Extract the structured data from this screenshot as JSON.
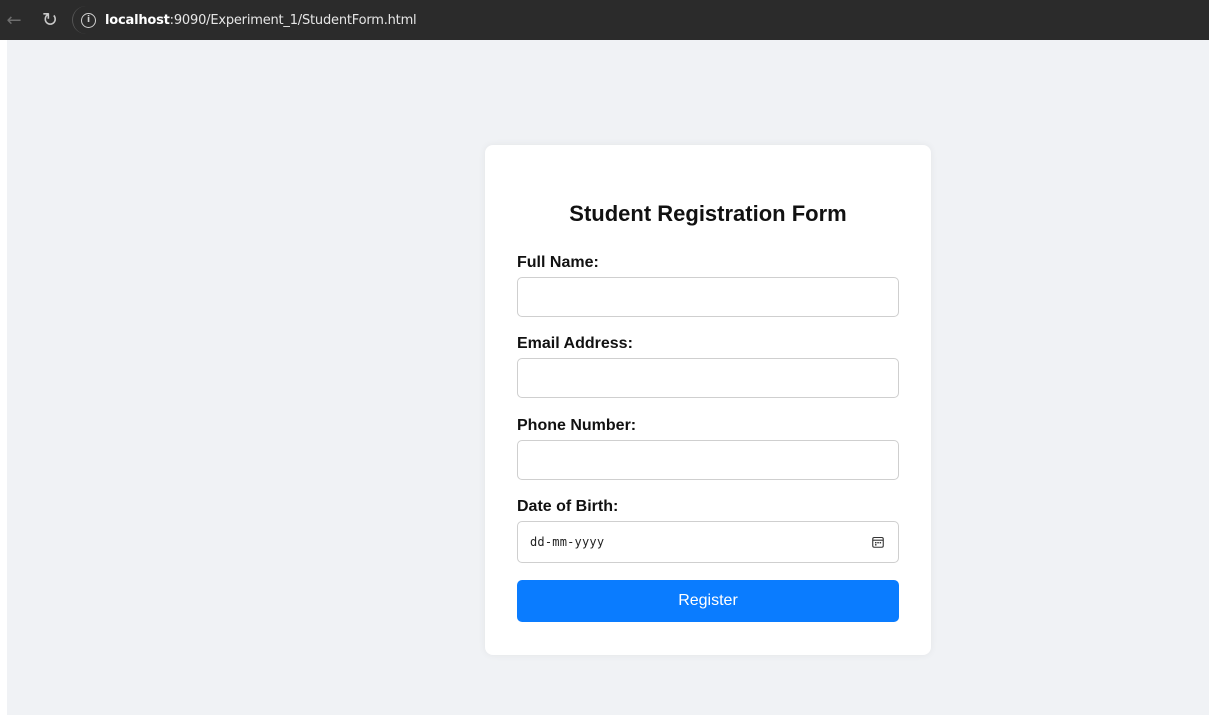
{
  "browser": {
    "url_host": "localhost",
    "url_path": ":9090/Experiment_1/StudentForm.html"
  },
  "form": {
    "title": "Student Registration Form",
    "fields": [
      {
        "label": "Full Name:",
        "value": ""
      },
      {
        "label": "Email Address:",
        "value": ""
      },
      {
        "label": "Phone Number:",
        "value": ""
      },
      {
        "label": "Date of Birth:",
        "placeholder": "dd-mm-yyyy"
      }
    ],
    "submit_label": "Register"
  },
  "colors": {
    "page_background": "#f0f2f5",
    "card_background": "#ffffff",
    "button_background": "#0a7cff",
    "browser_bar": "#2b2b2b"
  },
  "icons": {
    "back": "arrow-left-icon",
    "reload": "reload-icon",
    "site_info": "info-icon",
    "date_picker": "calendar-icon"
  }
}
